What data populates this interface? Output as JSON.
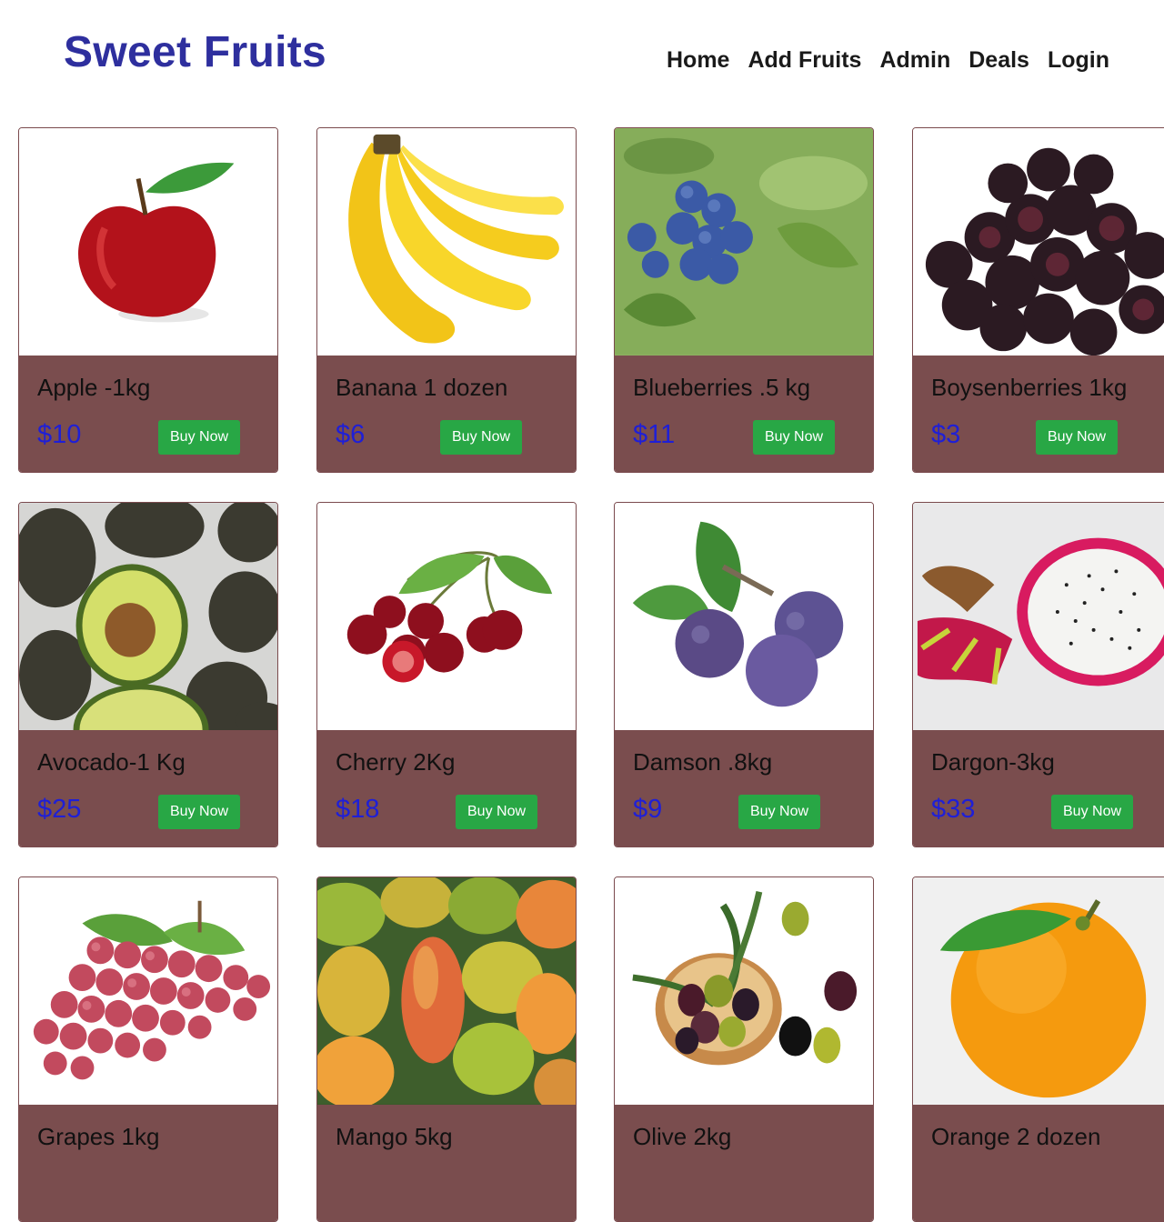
{
  "header": {
    "brand": "Sweet Fruits",
    "nav": [
      "Home",
      "Add Fruits",
      "Admin",
      "Deals",
      "Login"
    ]
  },
  "cards": [
    {
      "name": "Apple -1kg",
      "price": "$10",
      "button": "Buy Now",
      "image": "apple-image"
    },
    {
      "name": "Banana 1 dozen",
      "price": "$6",
      "button": "Buy Now",
      "image": "banana-image"
    },
    {
      "name": "Blueberries .5 kg",
      "price": "$11",
      "button": "Buy Now",
      "image": "blueberries-image"
    },
    {
      "name": "Boysenberries 1kg",
      "price": "$3",
      "button": "Buy Now",
      "image": "boysenberries-image"
    },
    {
      "name": "Avocado-1 Kg",
      "price": "$25",
      "button": "Buy Now",
      "image": "avocado-image"
    },
    {
      "name": "Cherry 2Kg",
      "price": "$18",
      "button": "Buy Now",
      "image": "cherry-image"
    },
    {
      "name": "Damson .8kg",
      "price": "$9",
      "button": "Buy Now",
      "image": "damson-image"
    },
    {
      "name": "Dargon-3kg",
      "price": "$33",
      "button": "Buy Now",
      "image": "dragonfruit-image"
    },
    {
      "name": "Grapes 1kg",
      "price": "",
      "button": "",
      "image": "grapes-image"
    },
    {
      "name": "Mango 5kg",
      "price": "",
      "button": "",
      "image": "mango-image"
    },
    {
      "name": "Olive 2kg",
      "price": "",
      "button": "",
      "image": "olive-image"
    },
    {
      "name": "Orange 2 dozen",
      "price": "",
      "button": "",
      "image": "orange-image"
    }
  ],
  "colors": {
    "brand": "#2e2f9e",
    "card_info_bg": "#7a4d4e",
    "price": "#1f1fd6",
    "button": "#28a745"
  }
}
